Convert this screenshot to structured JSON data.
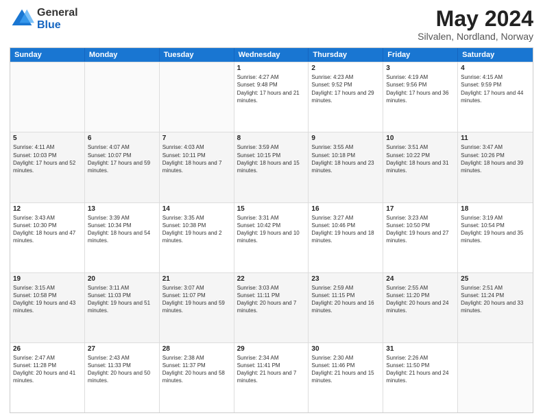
{
  "logo": {
    "general": "General",
    "blue": "Blue"
  },
  "title": "May 2024",
  "subtitle": "Silvalen, Nordland, Norway",
  "days_of_week": [
    "Sunday",
    "Monday",
    "Tuesday",
    "Wednesday",
    "Thursday",
    "Friday",
    "Saturday"
  ],
  "weeks": [
    [
      {
        "day": "",
        "sunrise": "",
        "sunset": "",
        "daylight": "",
        "empty": true
      },
      {
        "day": "",
        "sunrise": "",
        "sunset": "",
        "daylight": "",
        "empty": true
      },
      {
        "day": "",
        "sunrise": "",
        "sunset": "",
        "daylight": "",
        "empty": true
      },
      {
        "day": "1",
        "sunrise": "Sunrise: 4:27 AM",
        "sunset": "Sunset: 9:48 PM",
        "daylight": "Daylight: 17 hours and 21 minutes.",
        "empty": false
      },
      {
        "day": "2",
        "sunrise": "Sunrise: 4:23 AM",
        "sunset": "Sunset: 9:52 PM",
        "daylight": "Daylight: 17 hours and 29 minutes.",
        "empty": false
      },
      {
        "day": "3",
        "sunrise": "Sunrise: 4:19 AM",
        "sunset": "Sunset: 9:56 PM",
        "daylight": "Daylight: 17 hours and 36 minutes.",
        "empty": false
      },
      {
        "day": "4",
        "sunrise": "Sunrise: 4:15 AM",
        "sunset": "Sunset: 9:59 PM",
        "daylight": "Daylight: 17 hours and 44 minutes.",
        "empty": false
      }
    ],
    [
      {
        "day": "5",
        "sunrise": "Sunrise: 4:11 AM",
        "sunset": "Sunset: 10:03 PM",
        "daylight": "Daylight: 17 hours and 52 minutes.",
        "empty": false
      },
      {
        "day": "6",
        "sunrise": "Sunrise: 4:07 AM",
        "sunset": "Sunset: 10:07 PM",
        "daylight": "Daylight: 17 hours and 59 minutes.",
        "empty": false
      },
      {
        "day": "7",
        "sunrise": "Sunrise: 4:03 AM",
        "sunset": "Sunset: 10:11 PM",
        "daylight": "Daylight: 18 hours and 7 minutes.",
        "empty": false
      },
      {
        "day": "8",
        "sunrise": "Sunrise: 3:59 AM",
        "sunset": "Sunset: 10:15 PM",
        "daylight": "Daylight: 18 hours and 15 minutes.",
        "empty": false
      },
      {
        "day": "9",
        "sunrise": "Sunrise: 3:55 AM",
        "sunset": "Sunset: 10:18 PM",
        "daylight": "Daylight: 18 hours and 23 minutes.",
        "empty": false
      },
      {
        "day": "10",
        "sunrise": "Sunrise: 3:51 AM",
        "sunset": "Sunset: 10:22 PM",
        "daylight": "Daylight: 18 hours and 31 minutes.",
        "empty": false
      },
      {
        "day": "11",
        "sunrise": "Sunrise: 3:47 AM",
        "sunset": "Sunset: 10:26 PM",
        "daylight": "Daylight: 18 hours and 39 minutes.",
        "empty": false
      }
    ],
    [
      {
        "day": "12",
        "sunrise": "Sunrise: 3:43 AM",
        "sunset": "Sunset: 10:30 PM",
        "daylight": "Daylight: 18 hours and 47 minutes.",
        "empty": false
      },
      {
        "day": "13",
        "sunrise": "Sunrise: 3:39 AM",
        "sunset": "Sunset: 10:34 PM",
        "daylight": "Daylight: 18 hours and 54 minutes.",
        "empty": false
      },
      {
        "day": "14",
        "sunrise": "Sunrise: 3:35 AM",
        "sunset": "Sunset: 10:38 PM",
        "daylight": "Daylight: 19 hours and 2 minutes.",
        "empty": false
      },
      {
        "day": "15",
        "sunrise": "Sunrise: 3:31 AM",
        "sunset": "Sunset: 10:42 PM",
        "daylight": "Daylight: 19 hours and 10 minutes.",
        "empty": false
      },
      {
        "day": "16",
        "sunrise": "Sunrise: 3:27 AM",
        "sunset": "Sunset: 10:46 PM",
        "daylight": "Daylight: 19 hours and 18 minutes.",
        "empty": false
      },
      {
        "day": "17",
        "sunrise": "Sunrise: 3:23 AM",
        "sunset": "Sunset: 10:50 PM",
        "daylight": "Daylight: 19 hours and 27 minutes.",
        "empty": false
      },
      {
        "day": "18",
        "sunrise": "Sunrise: 3:19 AM",
        "sunset": "Sunset: 10:54 PM",
        "daylight": "Daylight: 19 hours and 35 minutes.",
        "empty": false
      }
    ],
    [
      {
        "day": "19",
        "sunrise": "Sunrise: 3:15 AM",
        "sunset": "Sunset: 10:58 PM",
        "daylight": "Daylight: 19 hours and 43 minutes.",
        "empty": false
      },
      {
        "day": "20",
        "sunrise": "Sunrise: 3:11 AM",
        "sunset": "Sunset: 11:03 PM",
        "daylight": "Daylight: 19 hours and 51 minutes.",
        "empty": false
      },
      {
        "day": "21",
        "sunrise": "Sunrise: 3:07 AM",
        "sunset": "Sunset: 11:07 PM",
        "daylight": "Daylight: 19 hours and 59 minutes.",
        "empty": false
      },
      {
        "day": "22",
        "sunrise": "Sunrise: 3:03 AM",
        "sunset": "Sunset: 11:11 PM",
        "daylight": "Daylight: 20 hours and 7 minutes.",
        "empty": false
      },
      {
        "day": "23",
        "sunrise": "Sunrise: 2:59 AM",
        "sunset": "Sunset: 11:15 PM",
        "daylight": "Daylight: 20 hours and 16 minutes.",
        "empty": false
      },
      {
        "day": "24",
        "sunrise": "Sunrise: 2:55 AM",
        "sunset": "Sunset: 11:20 PM",
        "daylight": "Daylight: 20 hours and 24 minutes.",
        "empty": false
      },
      {
        "day": "25",
        "sunrise": "Sunrise: 2:51 AM",
        "sunset": "Sunset: 11:24 PM",
        "daylight": "Daylight: 20 hours and 33 minutes.",
        "empty": false
      }
    ],
    [
      {
        "day": "26",
        "sunrise": "Sunrise: 2:47 AM",
        "sunset": "Sunset: 11:28 PM",
        "daylight": "Daylight: 20 hours and 41 minutes.",
        "empty": false
      },
      {
        "day": "27",
        "sunrise": "Sunrise: 2:43 AM",
        "sunset": "Sunset: 11:33 PM",
        "daylight": "Daylight: 20 hours and 50 minutes.",
        "empty": false
      },
      {
        "day": "28",
        "sunrise": "Sunrise: 2:38 AM",
        "sunset": "Sunset: 11:37 PM",
        "daylight": "Daylight: 20 hours and 58 minutes.",
        "empty": false
      },
      {
        "day": "29",
        "sunrise": "Sunrise: 2:34 AM",
        "sunset": "Sunset: 11:41 PM",
        "daylight": "Daylight: 21 hours and 7 minutes.",
        "empty": false
      },
      {
        "day": "30",
        "sunrise": "Sunrise: 2:30 AM",
        "sunset": "Sunset: 11:46 PM",
        "daylight": "Daylight: 21 hours and 15 minutes.",
        "empty": false
      },
      {
        "day": "31",
        "sunrise": "Sunrise: 2:26 AM",
        "sunset": "Sunset: 11:50 PM",
        "daylight": "Daylight: 21 hours and 24 minutes.",
        "empty": false
      },
      {
        "day": "",
        "sunrise": "",
        "sunset": "",
        "daylight": "",
        "empty": true
      }
    ]
  ]
}
